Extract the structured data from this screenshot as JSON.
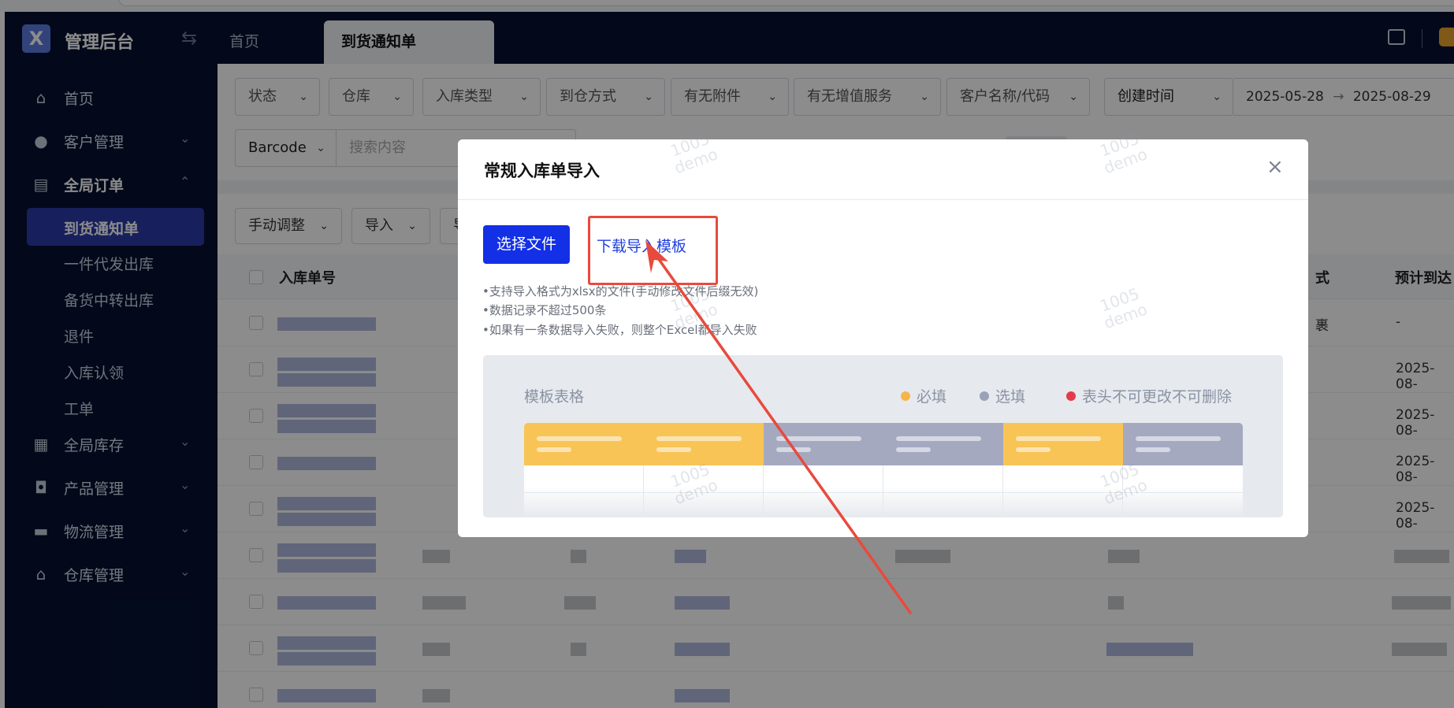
{
  "header": {
    "logo_text": "X",
    "app_title": "管理后台",
    "collapse_icon": "⇆",
    "tabs": [
      {
        "label": "首页"
      },
      {
        "label": "到货通知单"
      }
    ]
  },
  "sidebar": {
    "items": [
      {
        "label": "首页",
        "icon": "home-icon"
      },
      {
        "label": "客户管理",
        "icon": "users-icon"
      },
      {
        "label": "全局订单",
        "icon": "clipboard-icon"
      },
      {
        "label": "全局库存",
        "icon": "warehouse-icon"
      },
      {
        "label": "产品管理",
        "icon": "bag-icon"
      },
      {
        "label": "物流管理",
        "icon": "truck-icon"
      },
      {
        "label": "仓库管理",
        "icon": "store-icon"
      }
    ],
    "sub_items": [
      {
        "label": "到货通知单"
      },
      {
        "label": "一件代发出库"
      },
      {
        "label": "备货中转出库"
      },
      {
        "label": "退件"
      },
      {
        "label": "入库认领"
      },
      {
        "label": "工单"
      }
    ]
  },
  "filters": {
    "selects": [
      "状态",
      "仓库",
      "入库类型",
      "到仓方式",
      "有无附件",
      "有无增值服务",
      "客户名称/代码",
      "创建时间"
    ],
    "date_start": "2025-05-28",
    "date_arrow": "→",
    "date_end": "2025-08-29",
    "barcode_select": "Barcode",
    "search_placeholder": "搜索内容"
  },
  "actions": {
    "manual_adjust": "手动调整",
    "import": "导入",
    "third_partial": "导"
  },
  "table": {
    "headers": {
      "order_no": "入库单号",
      "method_partial": "式",
      "eta_partial": "预计到达"
    },
    "rows": [
      {
        "method_partial": "裹",
        "eta": "-"
      },
      {
        "eta": "2025-08-"
      },
      {
        "eta": "2025-08-"
      },
      {
        "eta": "2025-08-"
      },
      {
        "eta": "2025-08-"
      }
    ]
  },
  "modal": {
    "title": "常规入库单导入",
    "close": "×",
    "choose_file": "选择文件",
    "download_template": "下载导入模板",
    "tips": [
      "•支持导入格式为xlsx的文件(手动修改文件后缀无效)",
      "•数据记录不超过500条",
      "•如果有一条数据导入失败，则整个Excel都导入失败"
    ],
    "template_title": "模板表格",
    "legend": [
      {
        "label": "必填",
        "color": "#f5b547"
      },
      {
        "label": "选填",
        "color": "#9aa1b8"
      },
      {
        "label": "表头不可更改不可删除",
        "color": "#e53a4c"
      }
    ],
    "template_columns": [
      "required",
      "required",
      "optional",
      "optional",
      "required",
      "optional"
    ]
  },
  "watermark": {
    "line1": "1005",
    "line2": "demo"
  },
  "colors": {
    "header_bg": "#061231",
    "accent_blue": "#1330e6",
    "sidebar_active": "#2b3ba8",
    "required": "#f8c456",
    "optional": "#a4a9c0",
    "annotation_red": "#e84a3c"
  }
}
